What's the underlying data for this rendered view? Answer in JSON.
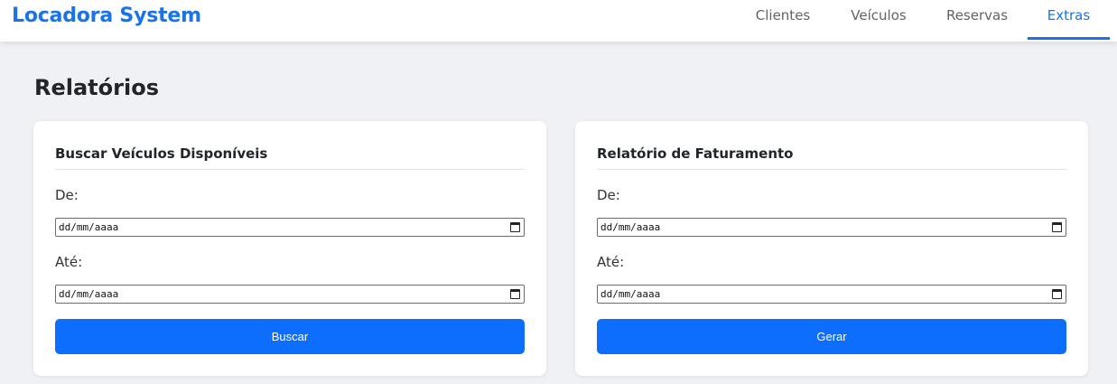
{
  "header": {
    "brand": "Locadora System",
    "nav": [
      {
        "label": "Clientes"
      },
      {
        "label": "Veículos"
      },
      {
        "label": "Reservas"
      },
      {
        "label": "Extras",
        "active": true
      }
    ]
  },
  "page": {
    "title": "Relatórios"
  },
  "cards": [
    {
      "title": "Buscar Veículos Disponíveis",
      "from_label": "De:",
      "from_placeholder": "dd/mm/aaaa",
      "to_label": "Até:",
      "to_placeholder": "dd/mm/aaaa",
      "button_label": "Buscar"
    },
    {
      "title": "Relatório de Faturamento",
      "from_label": "De:",
      "from_placeholder": "dd/mm/aaaa",
      "to_label": "Até:",
      "to_placeholder": "dd/mm/aaaa",
      "button_label": "Gerar"
    }
  ],
  "colors": {
    "brand": "#1a73e8",
    "primary_button": "#0d6efd",
    "background": "#f0f1f5"
  },
  "icons": [
    "calendar-icon"
  ]
}
